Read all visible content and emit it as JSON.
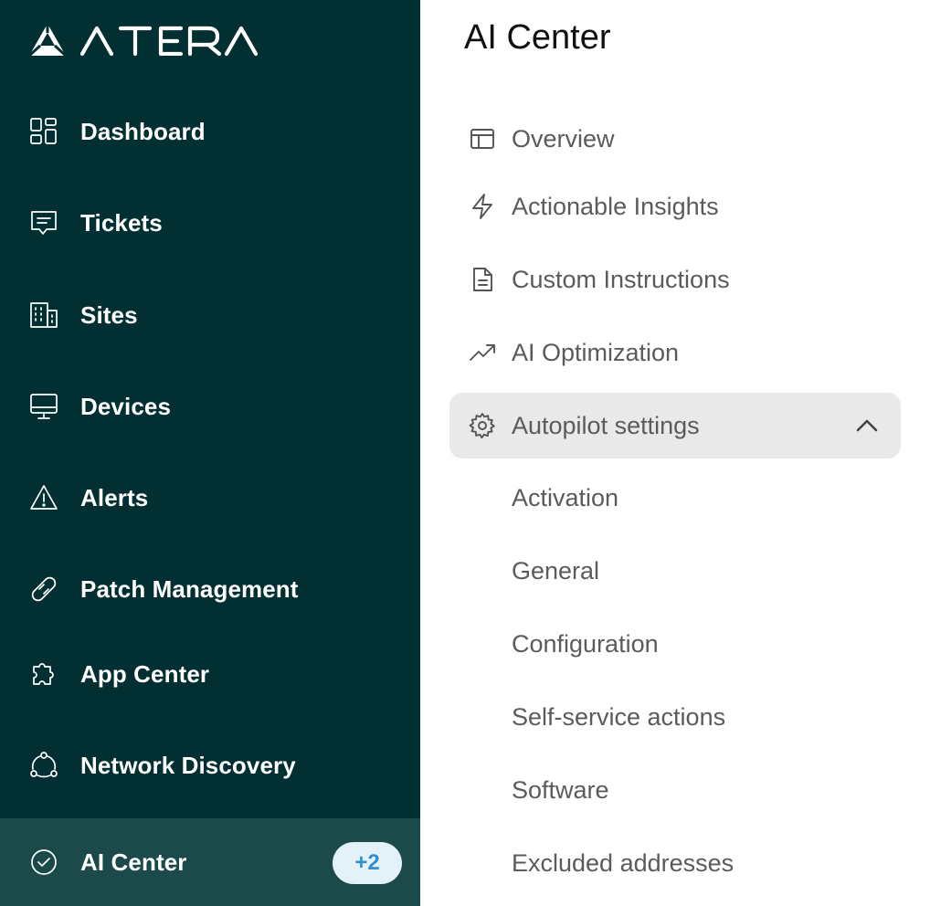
{
  "brand": {
    "name": "ATERA",
    "mark_icon": "atera-logo-icon",
    "sidebar_bg": "#022f32",
    "active_bg": "#1c4a4b"
  },
  "sidebar": {
    "items": [
      {
        "label": "Dashboard",
        "icon": "dashboard-grid-icon"
      },
      {
        "label": "Tickets",
        "icon": "chat-ticket-icon"
      },
      {
        "label": "Sites",
        "icon": "building-icon"
      },
      {
        "label": "Devices",
        "icon": "monitor-icon"
      },
      {
        "label": "Alerts",
        "icon": "warning-triangle-icon"
      },
      {
        "label": "Patch Management",
        "icon": "bandage-icon"
      },
      {
        "label": "App Center",
        "icon": "puzzle-icon"
      },
      {
        "label": "Network Discovery",
        "icon": "network-icon"
      },
      {
        "label": "AI Center",
        "icon": "check-circle-icon",
        "badge": "+2",
        "active": true
      }
    ]
  },
  "panel": {
    "title": "AI Center",
    "menu": [
      {
        "label": "Overview",
        "icon": "layout-icon"
      },
      {
        "label": "Actionable Insights",
        "icon": "lightning-icon"
      },
      {
        "label": "Custom Instructions",
        "icon": "document-icon"
      },
      {
        "label": "AI Optimization",
        "icon": "trending-up-icon"
      },
      {
        "label": "Autopilot settings",
        "icon": "gear-icon",
        "expanded": true
      }
    ],
    "submenu": [
      {
        "label": "Activation"
      },
      {
        "label": "General"
      },
      {
        "label": "Configuration"
      },
      {
        "label": "Self-service actions"
      },
      {
        "label": "Software"
      },
      {
        "label": "Excluded addresses"
      }
    ]
  }
}
